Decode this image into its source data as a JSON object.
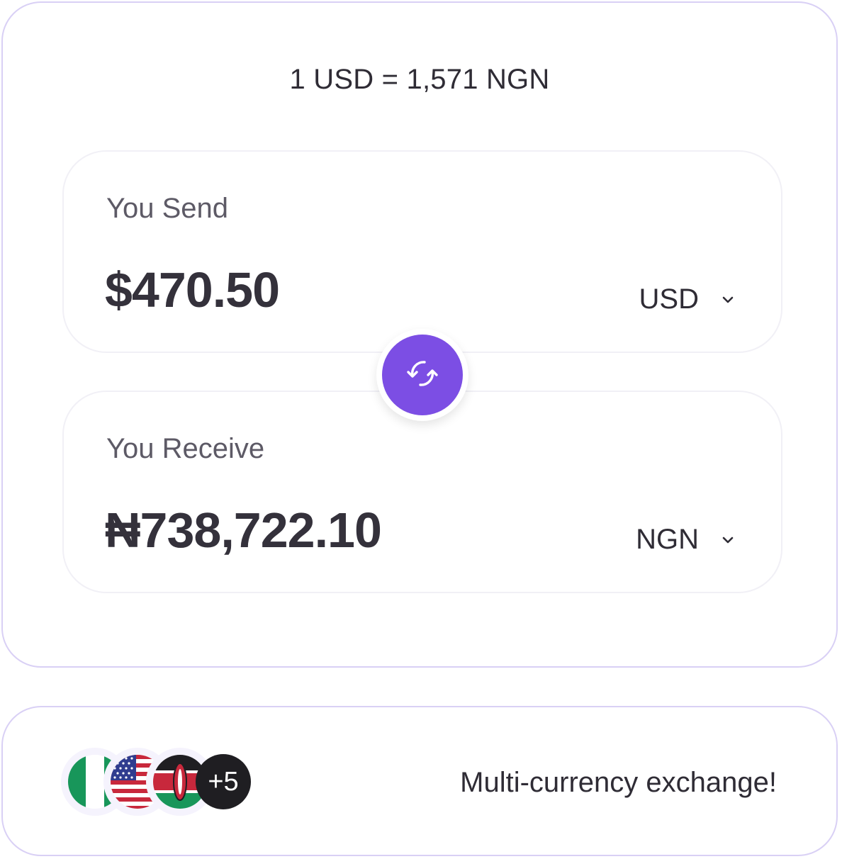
{
  "rate": {
    "text": "1 USD = 1,571 NGN"
  },
  "send": {
    "label": "You Send",
    "amount": "$470.50",
    "currency": "USD"
  },
  "receive": {
    "label": "You Receive",
    "amount": "₦738,722.10",
    "currency": "NGN"
  },
  "swap": {
    "icon": "swap-refresh-icon",
    "color": "#7c4ee4"
  },
  "currencies": {
    "flags": [
      "nigeria-flag-icon",
      "usa-flag-icon",
      "kenya-flag-icon"
    ],
    "more_label": "+5",
    "tagline": "Multi-currency exchange!"
  },
  "colors": {
    "accent": "#7c4ee4",
    "card_border": "#d9d0f5",
    "text": "#2f2c35"
  }
}
